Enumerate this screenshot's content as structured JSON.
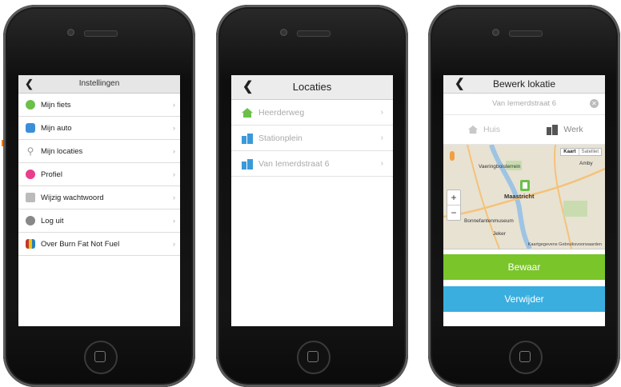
{
  "screens": {
    "settings": {
      "title": "Instellingen",
      "back_icon": "chevron-left-icon",
      "items": [
        {
          "label": "Mijn fiets",
          "icon": "bike-icon",
          "color": "#6cc04a"
        },
        {
          "label": "Mijn auto",
          "icon": "car-icon",
          "color": "#3a8fd8"
        },
        {
          "label": "Mijn locaties",
          "icon": "location-pin-icon",
          "color": "#999999"
        },
        {
          "label": "Profiel",
          "icon": "profile-icon",
          "color": "#e83e8c"
        },
        {
          "label": "Wijzig wachtwoord",
          "icon": "lock-icon",
          "color": "#aaaaaa"
        },
        {
          "label": "Log uit",
          "icon": "close-circle-icon",
          "color": "#888888"
        },
        {
          "label": "Over Burn Fat Not Fuel",
          "icon": "app-logo-icon",
          "color": "#c0392b"
        }
      ]
    },
    "locations": {
      "title": "Locaties",
      "items": [
        {
          "label": "Heerderweg",
          "icon": "home-icon",
          "color": "#6cc04a"
        },
        {
          "label": "Stationplein",
          "icon": "building-icon",
          "color": "#3a9ad9"
        },
        {
          "label": "Van Iemerdstraat 6",
          "icon": "building-icon",
          "color": "#3a9ad9"
        }
      ]
    },
    "edit": {
      "title": "Bewerk lokatie",
      "address_value": "Van Iemerdstraat 6",
      "types": {
        "home": "Huis",
        "work": "Werk"
      },
      "map": {
        "toggle_map": "Kaart",
        "toggle_satellite": "Satelliet",
        "city": "Maastricht",
        "label_north": "Vaeringboisterrein",
        "label_west": "Bonnefantenmuseum",
        "label_south": "Jeker",
        "label_east": "Amby",
        "footer": "Kaartgegevens  Gebruiksvoorwaarden"
      },
      "save_label": "Bewaar",
      "delete_label": "Verwijder"
    }
  },
  "colors": {
    "accent_arrow": "#f07c1a",
    "save": "#7ac52a",
    "delete": "#3aaedf"
  }
}
